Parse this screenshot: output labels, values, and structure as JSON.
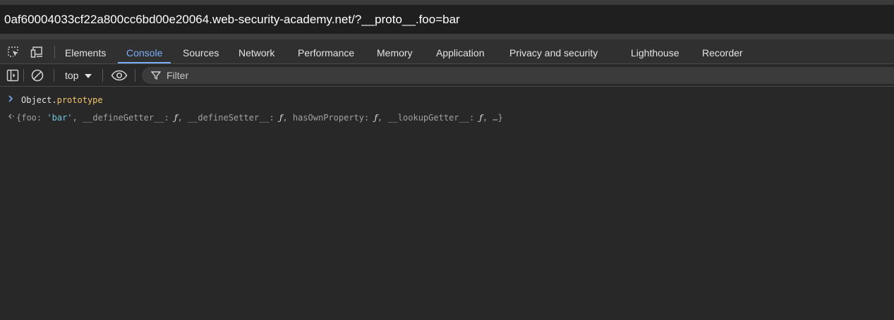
{
  "browser": {
    "url": "0af60004033cf22a800cc6bd00e20064.web-security-academy.net/?__proto__.foo=bar"
  },
  "devtools": {
    "tabs": [
      {
        "label": "Elements"
      },
      {
        "label": "Console",
        "active": true
      },
      {
        "label": "Sources"
      },
      {
        "label": "Network"
      },
      {
        "label": "Performance"
      },
      {
        "label": "Memory"
      },
      {
        "label": "Application"
      },
      {
        "label": "Privacy and security"
      },
      {
        "label": "Lighthouse"
      },
      {
        "label": "Recorder"
      }
    ],
    "icons": [
      "inspect-element-icon",
      "device-toolbar-icon"
    ],
    "accent_color": "#7cacf8"
  },
  "toolbar": {
    "icons": [
      "sidebar-toggle-icon",
      "clear-console-icon",
      "dropdown-arrow-icon",
      "live-expression-eye-icon",
      "filter-icon"
    ],
    "context": "top",
    "filter_placeholder": "Filter"
  },
  "console": {
    "input": {
      "object": "Object",
      "dot": ".",
      "property": "prototype"
    },
    "output": {
      "open_brace": "{",
      "foo_key": "foo",
      "colon1": ": ",
      "foo_value": "'bar'",
      "rest1": ", __defineGetter__: ",
      "fn1": "ƒ",
      "rest2": ", __defineSetter__: ",
      "fn2": "ƒ",
      "rest3": ", hasOwnProperty: ",
      "fn3": "ƒ",
      "rest4": ", __lookupGetter__: ",
      "fn4": "ƒ",
      "rest5": ", …}"
    }
  }
}
